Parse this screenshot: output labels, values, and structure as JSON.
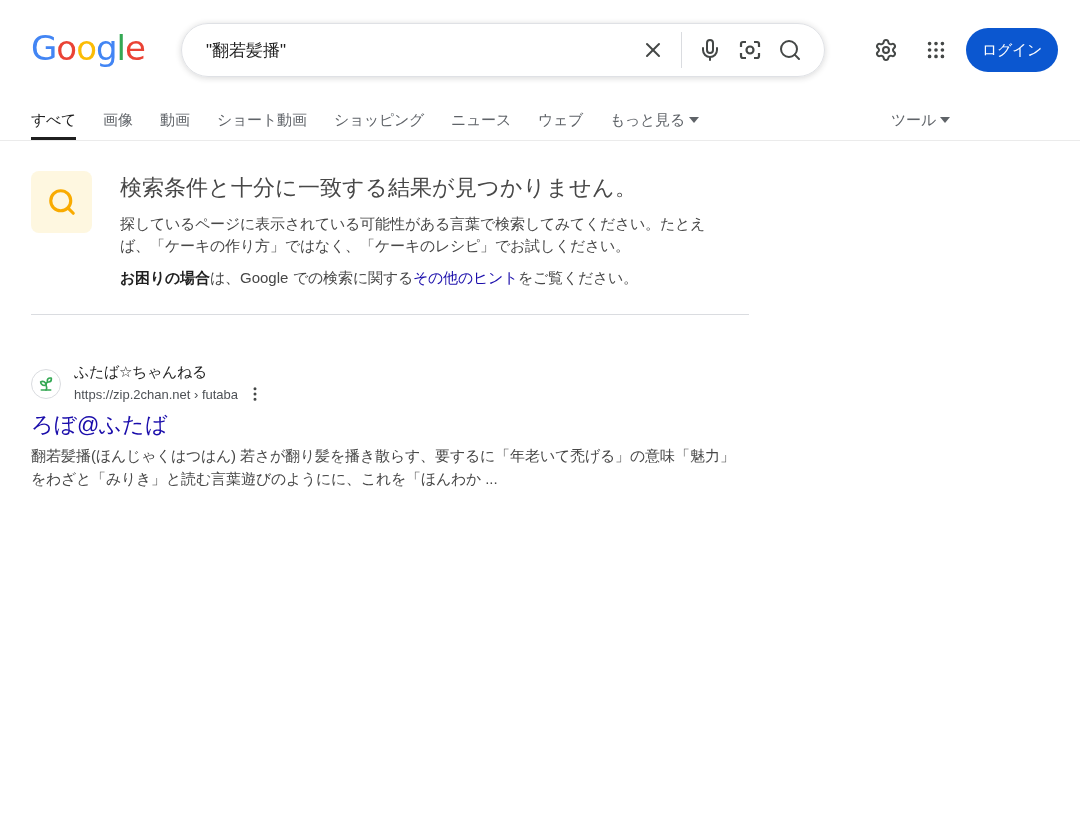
{
  "header": {
    "logo": "Google",
    "search": {
      "value": "\"翻若髪播\""
    },
    "login_button": "ログイン"
  },
  "tabs": [
    {
      "label": "すべて",
      "selected": true,
      "dropdown": false
    },
    {
      "label": "画像",
      "selected": false,
      "dropdown": false
    },
    {
      "label": "動画",
      "selected": false,
      "dropdown": false
    },
    {
      "label": "ショート動画",
      "selected": false,
      "dropdown": false
    },
    {
      "label": "ショッピング",
      "selected": false,
      "dropdown": false
    },
    {
      "label": "ニュース",
      "selected": false,
      "dropdown": false
    },
    {
      "label": "ウェブ",
      "selected": false,
      "dropdown": false
    },
    {
      "label": "もっと見る",
      "selected": false,
      "dropdown": true
    }
  ],
  "tools": {
    "label": "ツール"
  },
  "notice": {
    "title": "検索条件と十分に一致する結果が見つかりません。",
    "body": "探しているページに表示されている可能性がある言葉で検索してみてください。たとえば、「ケーキの作り方」ではなく、「ケーキのレシピ」でお試しください。",
    "help_prefix": "**お困りの場合**は、Google での検索に関する",
    "help_link": "その他のヒント",
    "help_suffix": "をご覧ください。"
  },
  "results": [
    {
      "site": "ふたば☆ちゃんねる",
      "url": "https://zip.2chan.net › futaba",
      "title": "ろぼ@ふたば",
      "snippet": "**翻若髪播**(ほんじゃくはつはん) 若さが翻り髪を播き散らす、要するに「年老いて禿げる」の意味「魅力」をわざと「みりき」と読む言葉遊びのようにに、これを「ほんわか ..."
    }
  ]
}
